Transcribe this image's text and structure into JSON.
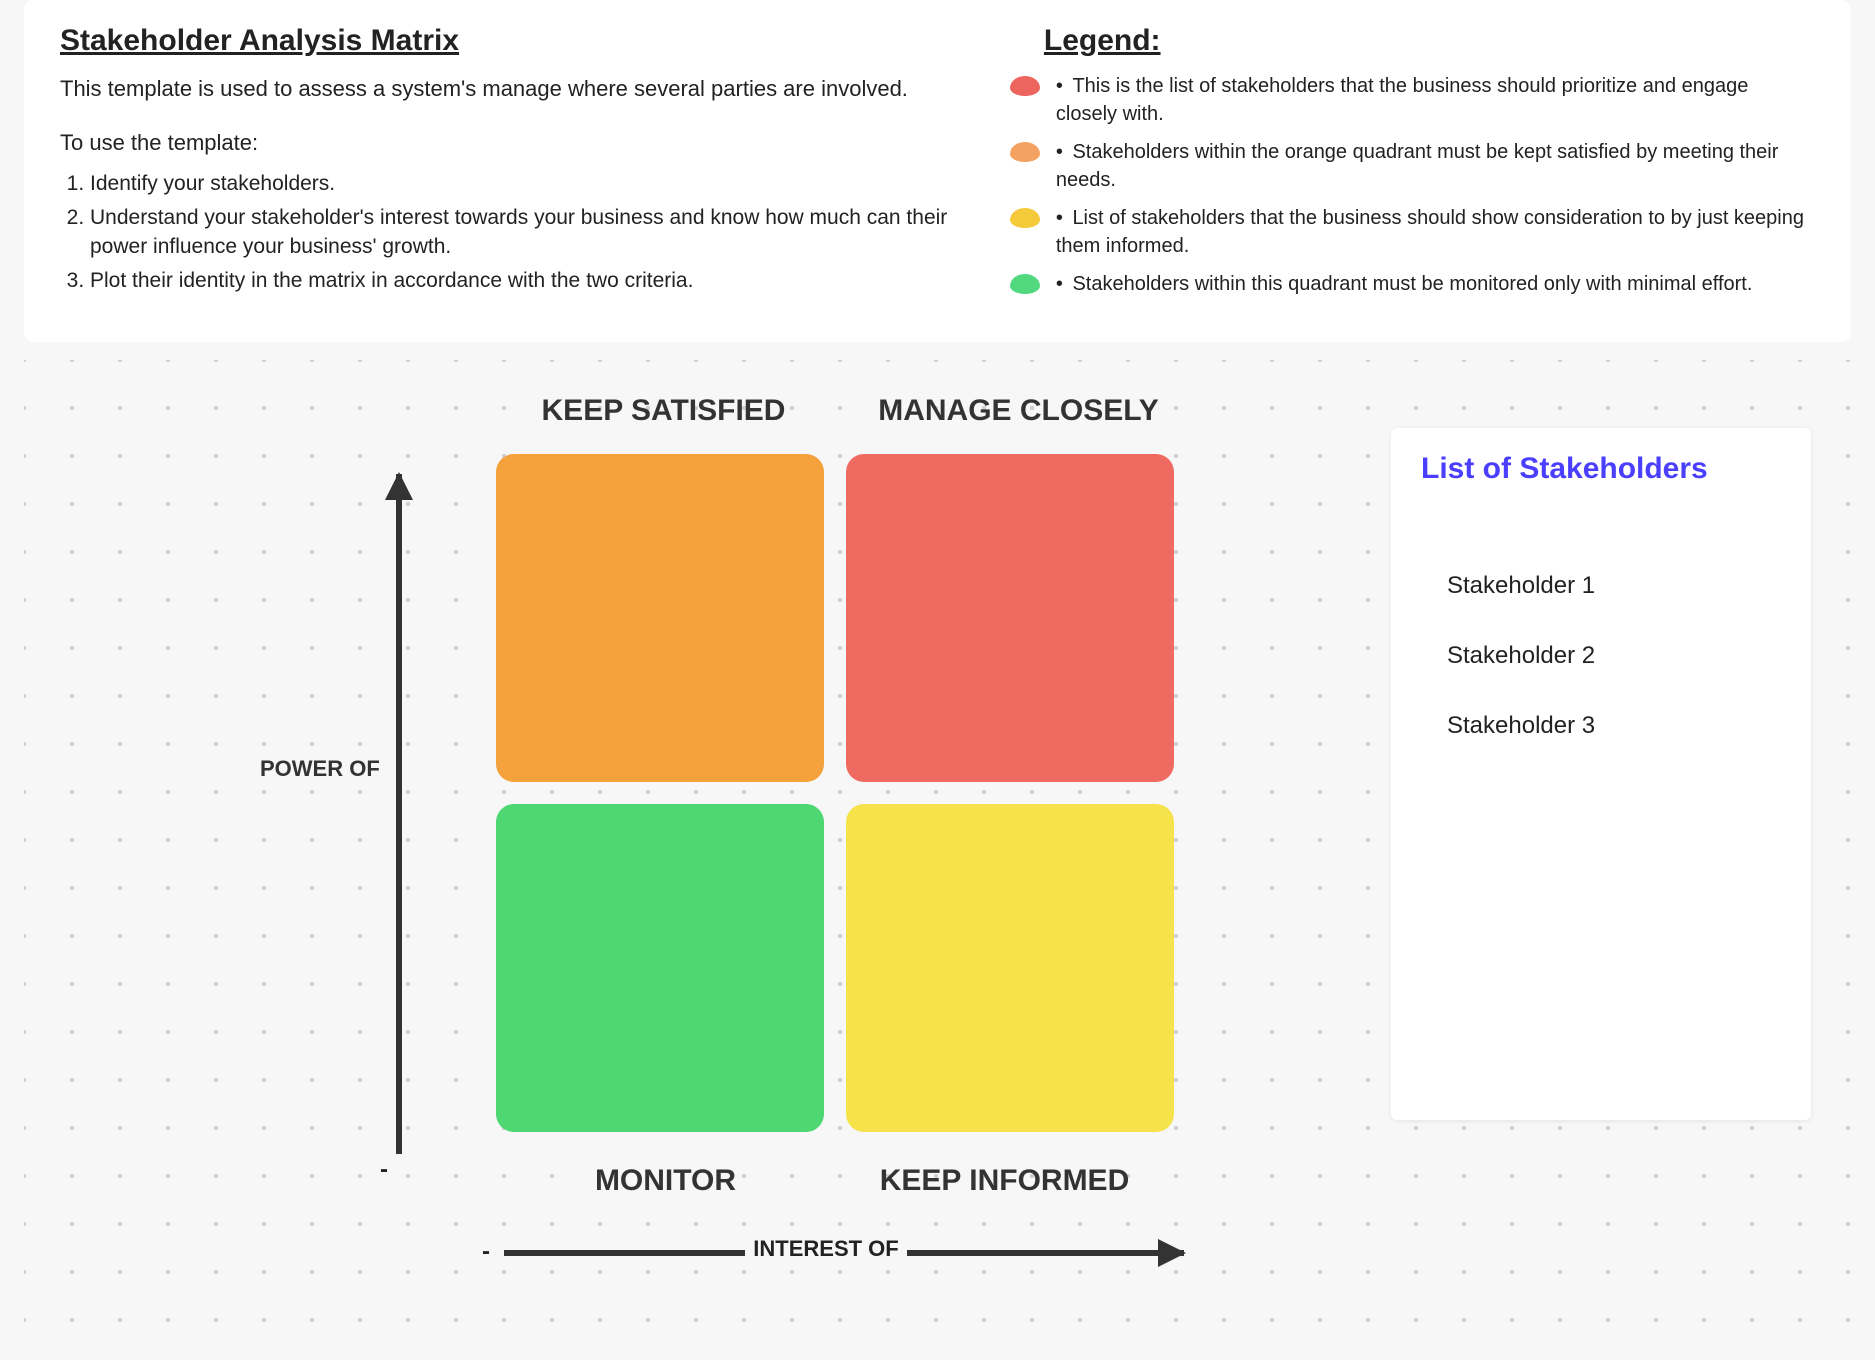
{
  "header": {
    "title": "Stakeholder Analysis Matrix",
    "description": "This template is used to assess a system's manage where several parties are involved.",
    "usage_intro": "To use the template:",
    "steps": [
      "Identify your stakeholders.",
      "Understand your stakeholder's interest towards your business and know how much can their power influence your business' growth.",
      "Plot their identity in the matrix in accordance with the two criteria."
    ]
  },
  "legend": {
    "title": "Legend:",
    "items": [
      {
        "color": "red",
        "text": "This is the list of stakeholders that the business should prioritize and engage closely with."
      },
      {
        "color": "orange",
        "text": "Stakeholders within the orange quadrant must be kept satisfied by meeting their needs."
      },
      {
        "color": "yellow",
        "text": "List of stakeholders that the business should show consideration to by just keeping them informed."
      },
      {
        "color": "green",
        "text": "Stakeholders within this quadrant must be monitored only with minimal effort."
      }
    ]
  },
  "chart_data": {
    "type": "matrix-2x2",
    "x_axis": {
      "label": "INTEREST OF",
      "low_marker": "-"
    },
    "y_axis": {
      "label": "POWER OF",
      "low_marker": "-"
    },
    "quadrants": {
      "top_left": {
        "label": "KEEP SATISFIED",
        "color": "#f5a23c"
      },
      "top_right": {
        "label": "MANAGE CLOSELY",
        "color": "#ef6b62"
      },
      "bottom_left": {
        "label": "MONITOR",
        "color": "#4fd774"
      },
      "bottom_right": {
        "label": "KEEP INFORMED",
        "color": "#f6e34b"
      }
    }
  },
  "stakeholders": {
    "title": "List of Stakeholders",
    "items": [
      "Stakeholder 1",
      "Stakeholder 2",
      "Stakeholder 3"
    ]
  }
}
